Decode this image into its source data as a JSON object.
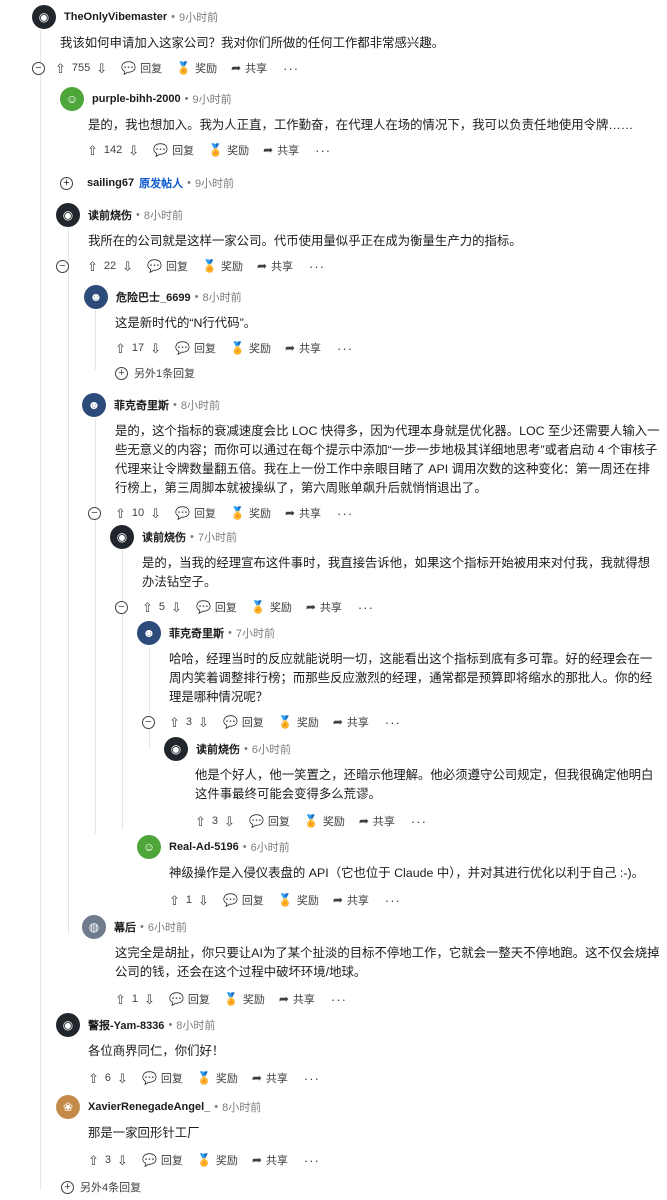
{
  "actions": {
    "reply": "回复",
    "award": "奖励",
    "share": "共享",
    "more": "···"
  },
  "op_label": "原发帖人",
  "avatar_colors": {
    "dark_alien": "#20262b",
    "green_bot": "#4ea63a",
    "blue_sunglasses": "#2c4a7a",
    "tan_dog": "#c48a4a",
    "grey_helmet": "#6e7c8c"
  },
  "comments": [
    {
      "user": "TheOnlyVibemaster",
      "time": "9小时前",
      "body": "我该如何申请加入这家公司？我对你们所做的任何工作都非常感兴趣。",
      "score": "755"
    },
    {
      "user": "purple-bihh-2000",
      "time": "9小时前",
      "body": "是的，我也想加入。我为人正直，工作勤奋，在代理人在场的情况下，我可以负责任地使用令牌……",
      "score": "142"
    },
    {
      "user": "sailing67",
      "time": "9小时前"
    },
    {
      "user": "读前烧伤",
      "time": "8小时前",
      "body": "我所在的公司就是这样一家公司。代币使用量似乎正在成为衡量生产力的指标。",
      "score": "22"
    },
    {
      "user": "危险巴士_6699",
      "time": "8小时前",
      "body": "这是新时代的“N行代码”。",
      "score": "17"
    },
    {
      "user": "菲克奇里斯",
      "time": "8小时前",
      "body": "是的，这个指标的衰减速度会比 LOC 快得多，因为代理本身就是优化器。LOC 至少还需要人输入一些无意义的内容；而你可以通过在每个提示中添加“一步一步地极其详细地思考”或者启动 4 个审核子代理来让令牌数量翻五倍。我在上一份工作中亲眼目睹了 API 调用次数的这种变化：第一周还在排行榜上，第三周脚本就被操纵了，第六周账单飙升后就悄悄退出了。",
      "score": "10"
    },
    {
      "user": "读前烧伤",
      "time": "7小时前",
      "body": "是的，当我的经理宣布这件事时，我直接告诉他，如果这个指标开始被用来对付我，我就得想办法钻空子。",
      "score": "5"
    },
    {
      "user": "菲克奇里斯",
      "time": "7小时前",
      "body": "哈哈，经理当时的反应就能说明一切，这能看出这个指标到底有多可靠。好的经理会在一周内笑着调整排行榜；而那些反应激烈的经理，通常都是预算即将缩水的那批人。你的经理是哪种情况呢？",
      "score": "3"
    },
    {
      "user": "读前烧伤",
      "time": "6小时前",
      "body": "他是个好人，他一笑置之，还暗示他理解。他必须遵守公司规定，但我很确定他明白这件事最终可能会变得多么荒谬。",
      "score": "3"
    },
    {
      "user": "Real-Ad-5196",
      "time": "6小时前",
      "body": "神级操作是入侵仪表盘的 API（它也位于 Claude 中），并对其进行优化以利于自己 :-)。",
      "score": "1"
    },
    {
      "user": "幕后",
      "time": "6小时前",
      "body": "这完全是胡扯，你只要让AI为了某个扯淡的目标不停地工作，它就会一整天不停地跑。这不仅会烧掉公司的钱，还会在这个过程中破坏环境/地球。",
      "score": "1"
    },
    {
      "user": "警报-Yam-8336",
      "time": "8小时前",
      "body": "各位商界同仁，你们好！",
      "score": "6"
    },
    {
      "user": "XavierRenegadeAngel_",
      "time": "8小时前",
      "body": "那是一家回形针工厂",
      "score": "3"
    }
  ],
  "more_replies": [
    "另外1条回复",
    "另外4条回复"
  ]
}
